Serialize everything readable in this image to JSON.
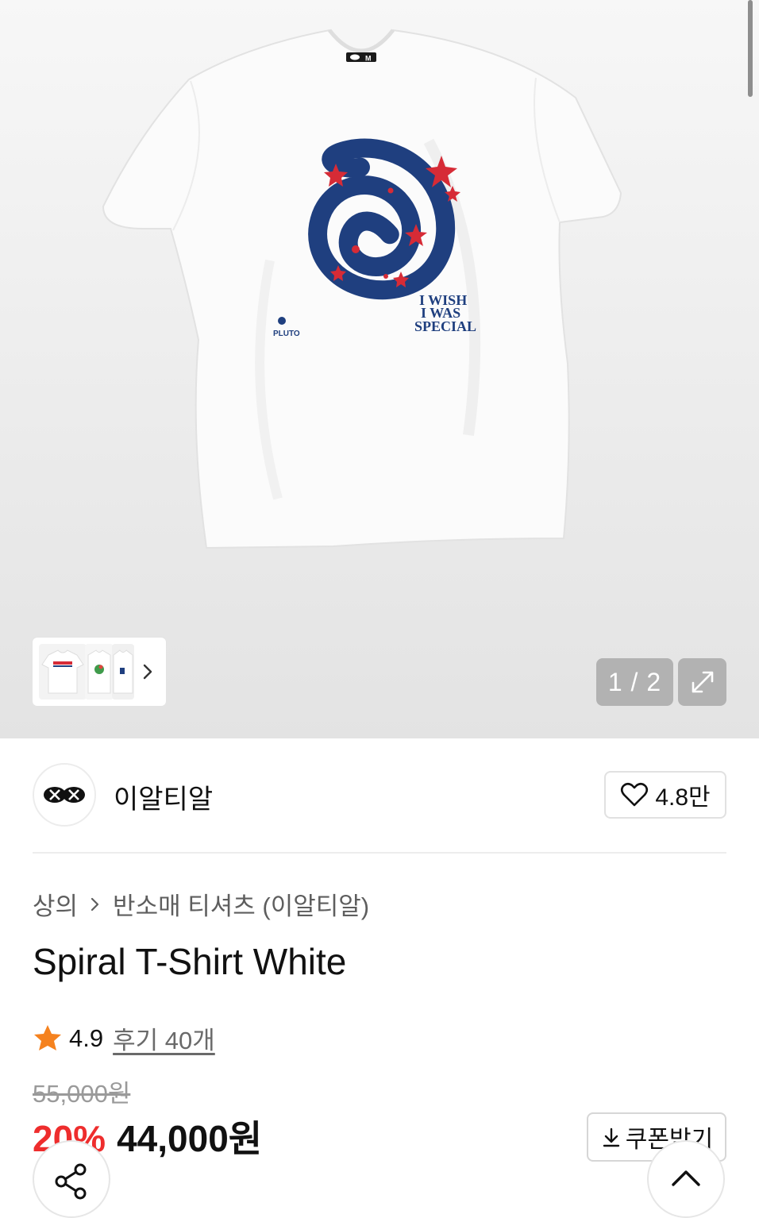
{
  "gallery": {
    "counter_text": "1 / 2",
    "print_text_lines": [
      "I WISH",
      "I WAS",
      "SPECIAL"
    ],
    "small_print_text": "PLUTO",
    "collar_tag_text": "M",
    "thumbnail_count": 3,
    "expand_icon": "expand-icon",
    "thumb_chevron_icon": "chevron-right-icon"
  },
  "brand": {
    "name": "이알티알",
    "like_count": "4.8만",
    "like_icon": "heart-outline-icon"
  },
  "breadcrumb": {
    "level1": "상의",
    "level2": "반소매 티셔츠 (이알티알)"
  },
  "product": {
    "title": "Spiral T-Shirt White",
    "rating": "4.9",
    "review_text": "후기 40개",
    "original_price": "55,000원",
    "discount": "20%",
    "price": "44,000원"
  },
  "coupon": {
    "label": "쿠폰받기",
    "icon": "download-icon"
  },
  "fabs": {
    "share_icon": "share-icon",
    "top_icon": "chevron-up-icon"
  },
  "colors": {
    "discount": "#ee2d2d",
    "star": "#f5821f",
    "spiral": "#1f3f7f",
    "stars_print": "#d62b36",
    "overlay": "#b2b2b2"
  }
}
